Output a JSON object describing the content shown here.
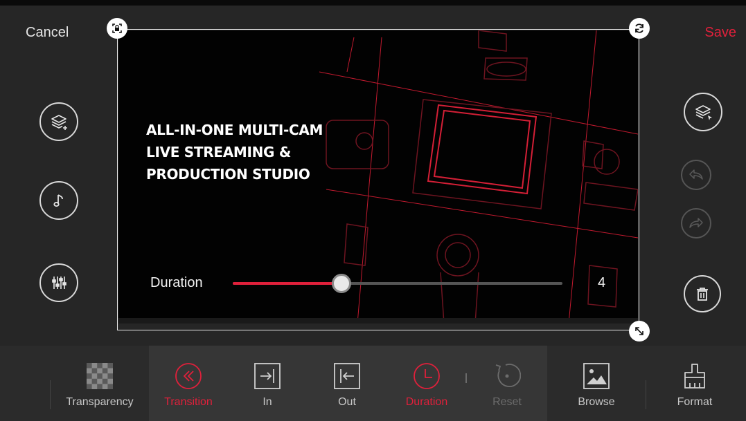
{
  "header": {
    "cancel_label": "Cancel",
    "save_label": "Save"
  },
  "left_tools": [
    {
      "name": "add-layer",
      "icon": "layers-plus-icon"
    },
    {
      "name": "music",
      "icon": "music-note-icon"
    },
    {
      "name": "mixer",
      "icon": "sliders-icon"
    }
  ],
  "right_tools": [
    {
      "name": "select-layer",
      "icon": "layers-cursor-icon"
    },
    {
      "name": "undo",
      "icon": "undo-icon",
      "enabled": false
    },
    {
      "name": "redo",
      "icon": "redo-icon",
      "enabled": false
    },
    {
      "name": "delete",
      "icon": "trash-icon"
    }
  ],
  "canvas": {
    "headline": [
      "ALL-IN-ONE MULTI-CAM",
      "LIVE STREAMING &",
      "PRODUCTION STUDIO"
    ],
    "handles": [
      "lock-icon",
      "rotate-icon",
      "resize-icon"
    ]
  },
  "duration": {
    "label": "Duration",
    "value": "4",
    "fraction": 0.33
  },
  "toolbar": {
    "items": [
      {
        "label": "Transparency",
        "icon": "checkerboard-icon"
      },
      {
        "label": "Transition",
        "icon": "double-chevron-left-icon",
        "active": true
      },
      {
        "label": "In",
        "icon": "enter-arrow-icon"
      },
      {
        "label": "Out",
        "icon": "exit-arrow-icon"
      },
      {
        "label": "Duration",
        "icon": "clock-icon",
        "active": true
      },
      {
        "label": "Reset",
        "icon": "reset-icon",
        "enabled": false
      },
      {
        "label": "Browse",
        "icon": "image-icon"
      },
      {
        "label": "Format",
        "icon": "brush-icon"
      }
    ]
  },
  "colors": {
    "accent": "#e0203b",
    "background": "#262626",
    "toolbar": "#2b2b2b",
    "canvas": "#020202"
  }
}
